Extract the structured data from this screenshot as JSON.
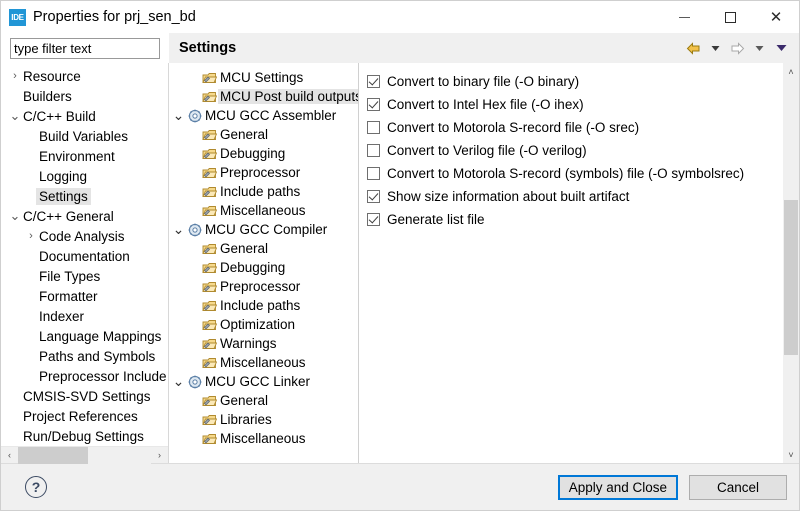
{
  "window": {
    "app_icon_text": "IDE",
    "title": "Properties for prj_sen_bd",
    "minimize_label": "Minimize",
    "maximize_label": "Maximize",
    "close_label": "Close"
  },
  "filter": {
    "placeholder": "type filter text",
    "value": ""
  },
  "header": {
    "title": "Settings",
    "nav": [
      {
        "name": "back-arrow-icon",
        "glyph": "back"
      },
      {
        "name": "back-dropdown-icon",
        "glyph": "chevron-gray"
      },
      {
        "name": "forward-arrow-icon",
        "glyph": "forward"
      },
      {
        "name": "forward-dropdown-icon",
        "glyph": "chevron-gray"
      },
      {
        "name": "menu-dropdown-icon",
        "glyph": "chevron-purple"
      }
    ]
  },
  "sidebar": {
    "items": [
      {
        "label": "Resource",
        "indent": 0,
        "state": "collapsed"
      },
      {
        "label": "Builders",
        "indent": 0,
        "state": "leaf"
      },
      {
        "label": "C/C++ Build",
        "indent": 0,
        "state": "expanded"
      },
      {
        "label": "Build Variables",
        "indent": 1,
        "state": "leaf"
      },
      {
        "label": "Environment",
        "indent": 1,
        "state": "leaf"
      },
      {
        "label": "Logging",
        "indent": 1,
        "state": "leaf"
      },
      {
        "label": "Settings",
        "indent": 1,
        "state": "leaf",
        "selected": true
      },
      {
        "label": "C/C++ General",
        "indent": 0,
        "state": "expanded"
      },
      {
        "label": "Code Analysis",
        "indent": 1,
        "state": "collapsed"
      },
      {
        "label": "Documentation",
        "indent": 1,
        "state": "leaf"
      },
      {
        "label": "File Types",
        "indent": 1,
        "state": "leaf"
      },
      {
        "label": "Formatter",
        "indent": 1,
        "state": "leaf"
      },
      {
        "label": "Indexer",
        "indent": 1,
        "state": "leaf"
      },
      {
        "label": "Language Mappings",
        "indent": 1,
        "state": "leaf"
      },
      {
        "label": "Paths and Symbols",
        "indent": 1,
        "state": "leaf"
      },
      {
        "label": "Preprocessor Include",
        "indent": 1,
        "state": "leaf"
      },
      {
        "label": "CMSIS-SVD Settings",
        "indent": 0,
        "state": "leaf"
      },
      {
        "label": "Project References",
        "indent": 0,
        "state": "leaf"
      },
      {
        "label": "Run/Debug Settings",
        "indent": 0,
        "state": "leaf"
      }
    ],
    "hscroll": {
      "left_arrow": "‹",
      "right_arrow": "›"
    }
  },
  "tool_tree": {
    "items": [
      {
        "label": "MCU Settings",
        "indent": 1,
        "icon": "tool-settings-icon",
        "state": "leaf"
      },
      {
        "label": "MCU Post build outputs",
        "indent": 1,
        "icon": "tool-settings-icon",
        "state": "leaf",
        "selected": true
      },
      {
        "label": "MCU GCC Assembler",
        "indent": 0,
        "icon": "gear-icon",
        "state": "expanded"
      },
      {
        "label": "General",
        "indent": 1,
        "icon": "tool-settings-icon",
        "state": "leaf"
      },
      {
        "label": "Debugging",
        "indent": 1,
        "icon": "tool-settings-icon",
        "state": "leaf"
      },
      {
        "label": "Preprocessor",
        "indent": 1,
        "icon": "tool-settings-icon",
        "state": "leaf"
      },
      {
        "label": "Include paths",
        "indent": 1,
        "icon": "tool-settings-icon",
        "state": "leaf"
      },
      {
        "label": "Miscellaneous",
        "indent": 1,
        "icon": "tool-settings-icon",
        "state": "leaf"
      },
      {
        "label": "MCU GCC Compiler",
        "indent": 0,
        "icon": "gear-icon",
        "state": "expanded"
      },
      {
        "label": "General",
        "indent": 1,
        "icon": "tool-settings-icon",
        "state": "leaf"
      },
      {
        "label": "Debugging",
        "indent": 1,
        "icon": "tool-settings-icon",
        "state": "leaf"
      },
      {
        "label": "Preprocessor",
        "indent": 1,
        "icon": "tool-settings-icon",
        "state": "leaf"
      },
      {
        "label": "Include paths",
        "indent": 1,
        "icon": "tool-settings-icon",
        "state": "leaf"
      },
      {
        "label": "Optimization",
        "indent": 1,
        "icon": "tool-settings-icon",
        "state": "leaf"
      },
      {
        "label": "Warnings",
        "indent": 1,
        "icon": "tool-settings-icon",
        "state": "leaf"
      },
      {
        "label": "Miscellaneous",
        "indent": 1,
        "icon": "tool-settings-icon",
        "state": "leaf"
      },
      {
        "label": "MCU GCC Linker",
        "indent": 0,
        "icon": "gear-icon",
        "state": "expanded"
      },
      {
        "label": "General",
        "indent": 1,
        "icon": "tool-settings-icon",
        "state": "leaf"
      },
      {
        "label": "Libraries",
        "indent": 1,
        "icon": "tool-settings-icon",
        "state": "leaf"
      },
      {
        "label": "Miscellaneous",
        "indent": 1,
        "icon": "tool-settings-icon",
        "state": "leaf"
      }
    ]
  },
  "options": {
    "checkboxes": [
      {
        "label": "Convert to binary file (-O binary)",
        "checked": true
      },
      {
        "label": "Convert to Intel Hex file (-O ihex)",
        "checked": true
      },
      {
        "label": "Convert to Motorola S-record file (-O srec)",
        "checked": false
      },
      {
        "label": "Convert to Verilog file (-O verilog)",
        "checked": false
      },
      {
        "label": "Convert to Motorola S-record (symbols) file (-O symbolsrec)",
        "checked": false
      },
      {
        "label": "Show size information about built artifact",
        "checked": true
      },
      {
        "label": "Generate list file",
        "checked": true
      }
    ],
    "vscroll": {
      "up_arrow": "˄",
      "down_arrow": "˅"
    }
  },
  "footer": {
    "help_label": "?",
    "apply_label": "Apply and Close",
    "cancel_label": "Cancel"
  }
}
